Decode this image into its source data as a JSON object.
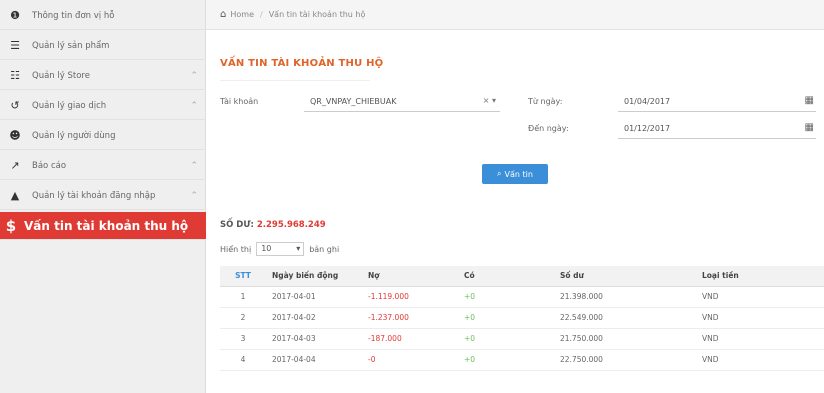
{
  "sidebar": {
    "items": [
      {
        "icon": "info-circle-icon",
        "glyph": "❶",
        "label": "Thông tin đơn vị hỗ",
        "has_chevron": false
      },
      {
        "icon": "list-icon",
        "glyph": "☰",
        "label": "Quản lý sản phẩm",
        "has_chevron": false
      },
      {
        "icon": "grid-icon",
        "glyph": "☷",
        "label": "Quản lý Store",
        "has_chevron": true
      },
      {
        "icon": "undo-icon",
        "glyph": "↺",
        "label": "Quản lý giao dịch",
        "has_chevron": true
      },
      {
        "icon": "users-icon",
        "glyph": "☻",
        "label": "Quản lý người dùng",
        "has_chevron": false
      },
      {
        "icon": "chart-icon",
        "glyph": "↗",
        "label": "Báo cáo",
        "has_chevron": true
      },
      {
        "icon": "user-icon",
        "glyph": "▲",
        "label": "Quản lý tài khoản đăng nhập",
        "has_chevron": true
      },
      {
        "icon": "dollar-icon",
        "glyph": "$",
        "label": "Vấn tin tài khoản thu hộ",
        "has_chevron": false,
        "active": true
      }
    ],
    "chevron": "⌃"
  },
  "breadcrumb": {
    "home": "Home",
    "separator": "/",
    "current": "Vấn tin tài khoản thu hộ"
  },
  "page": {
    "title": "VẤN TIN TÀI KHOẢN THU HỘ"
  },
  "form": {
    "account_label": "Tài khoản",
    "account_value": "QR_VNPAY_CHIEBUAK",
    "account_controls": "× ▾",
    "from_label": "Từ ngày:",
    "from_value": "01/04/2017",
    "to_label": "Đến ngày:",
    "to_value": "01/12/2017",
    "search_label": "Vấn tin"
  },
  "balance": {
    "label": "SỐ DƯ:",
    "amount": "2.295.968.249"
  },
  "paging": {
    "show_label": "Hiển thị",
    "page_size": "10",
    "suffix": "bản ghi"
  },
  "table": {
    "columns": [
      "STT",
      "Ngày biến động",
      "Nợ",
      "Có",
      "Số dư",
      "Loại tiền"
    ],
    "rows": [
      {
        "stt": "1",
        "date": "2017-04-01",
        "no": "-1.119.000",
        "co": "+0",
        "balance": "21.398.000",
        "currency": "VND"
      },
      {
        "stt": "2",
        "date": "2017-04-02",
        "no": "-1.237.000",
        "co": "+0",
        "balance": "22.549.000",
        "currency": "VND"
      },
      {
        "stt": "3",
        "date": "2017-04-03",
        "no": "-187.000",
        "co": "+0",
        "balance": "21.750.000",
        "currency": "VND"
      },
      {
        "stt": "4",
        "date": "2017-04-04",
        "no": "-0",
        "co": "+0",
        "balance": "22.750.000",
        "currency": "VND"
      }
    ]
  },
  "colors": {
    "accent_red": "#e03a34",
    "title_orange": "#e0632a",
    "button_blue": "#3a8fd8",
    "credit_green": "#6bbf59"
  }
}
